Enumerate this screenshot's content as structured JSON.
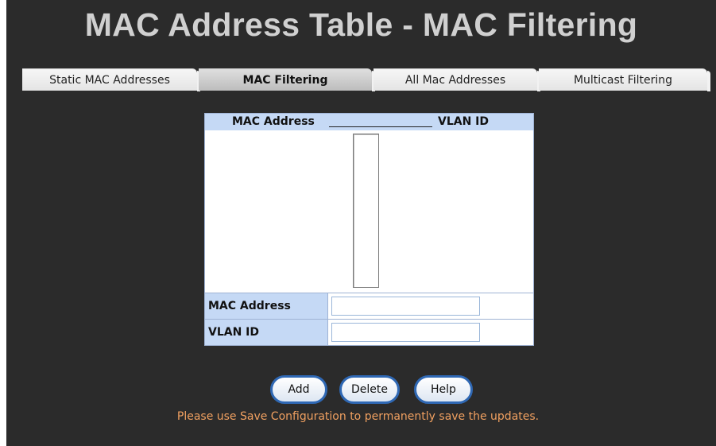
{
  "page": {
    "title": "MAC Address Table - MAC Filtering",
    "save_note": "Please use Save Configuration to permanently save the updates."
  },
  "tabs": [
    {
      "label": "Static MAC Addresses",
      "active": false
    },
    {
      "label": "MAC Filtering",
      "active": true
    },
    {
      "label": "All Mac Addresses",
      "active": false
    },
    {
      "label": "Multicast Filtering",
      "active": false
    }
  ],
  "table": {
    "header_mac": "MAC Address",
    "header_vlan": "VLAN ID",
    "entries": []
  },
  "form": {
    "mac_label": "MAC Address",
    "mac_value": "",
    "vlan_label": "VLAN ID",
    "vlan_value": ""
  },
  "buttons": {
    "add": "Add",
    "delete": "Delete",
    "help": "Help"
  },
  "colors": {
    "background": "#2b2b2b",
    "header_fill": "#c5d9f5",
    "button_border": "#2f68b4",
    "note_text": "#f0a060"
  }
}
